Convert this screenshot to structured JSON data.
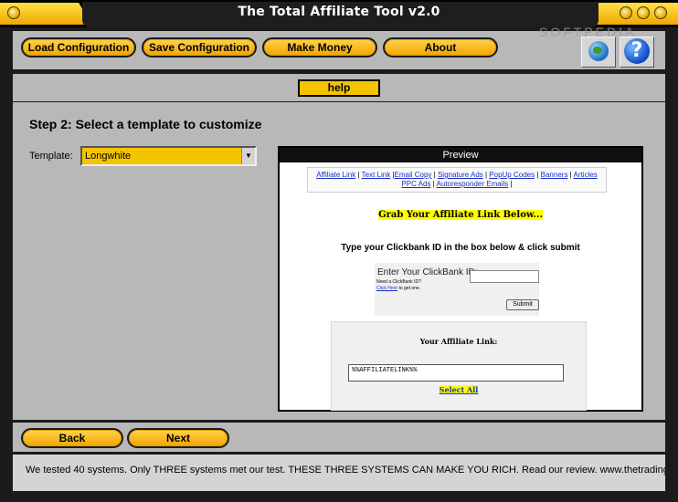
{
  "window": {
    "title": "The Total Affiliate Tool v2.0",
    "watermark": "SOFTPEDIA"
  },
  "toolbar": {
    "load_label": "Load Configuration",
    "save_label": "Save Configuration",
    "money_label": "Make Money",
    "about_label": "About",
    "help_icon_glyph": "?"
  },
  "help_tab": "help",
  "step": {
    "title": "Step 2: Select a template to customize",
    "template_label": "Template:",
    "template_value": "Longwhite"
  },
  "preview": {
    "header": "Preview",
    "links": [
      "Affiliate Link",
      "Text Link",
      "Email Copy",
      "Signature Ads",
      "PopUp Codes",
      "Banners",
      "Articles",
      "PPC Ads",
      "Autoresponder Emails"
    ],
    "grab_heading": "Grab Your Affiliate Link Below...",
    "instructions": "Type your Clickbank ID in the box below & click submit",
    "cb_label": "Enter Your ClickBank ID:",
    "cb_need": "Need a ClickBank ID?",
    "cb_click_link": "Click Here",
    "cb_click_rest": " to get one.",
    "submit_label": "Submit",
    "aff_title": "Your Affiliate Link:",
    "aff_value": "%%AFFILIATELINK%%",
    "select_all": "Select All"
  },
  "nav": {
    "back_label": "Back",
    "next_label": "Next"
  },
  "ticker": "We tested 40 systems. Only THREE systems met our test. THESE THREE SYSTEMS CAN MAKE YOU RICH. Read our review. www.thetradingmas",
  "colors": {
    "accent": "#f5c400",
    "frame": "#1b1b1b",
    "panel": "#b8b8b8"
  }
}
